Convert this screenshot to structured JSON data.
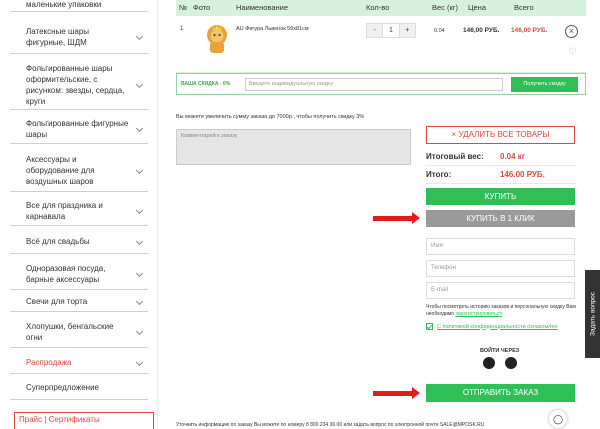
{
  "sidebar": {
    "items": [
      {
        "label": "маленькие упаковки",
        "red": false
      },
      {
        "label": "Латексные шары фигурные, ШДМ",
        "red": false
      },
      {
        "label": "Фольгированные шары оформительские, с рисунком: звезды, сердца, круги",
        "red": false
      },
      {
        "label": "Фольгированные фигурные шары",
        "red": false
      },
      {
        "label": "Аксессуары и оборудование для воздушных шаров",
        "red": false
      },
      {
        "label": "Все для праздника и карнавала",
        "red": false
      },
      {
        "label": "Всё для свадьбы",
        "red": false
      },
      {
        "label": "Одноразовая посуда, барные аксессуары",
        "red": false
      },
      {
        "label": "Свечи для торта",
        "red": false
      },
      {
        "label": "Хлопушки, бенгальские огни",
        "red": false
      },
      {
        "label": "Распродажа",
        "red": true
      },
      {
        "label": "Суперпредложение",
        "red": false
      }
    ],
    "bottom_links": "Прайс | Сертификаты"
  },
  "table": {
    "headers": {
      "num": "№",
      "photo": "Фото",
      "name": "Наименование",
      "qty": "Кол-во",
      "weight": "Вес (кг)",
      "price": "Цена",
      "total": "Всего"
    },
    "rows": [
      {
        "num": "1",
        "name": "AU Фигура Львенок 56х81см",
        "qty_minus": "-",
        "qty": "1",
        "qty_plus": "+",
        "weight": "0.04",
        "price": "146,00 РУБ.",
        "total": "146,00 РУБ."
      }
    ]
  },
  "discount": {
    "label": "ВАША СКИДКА - 0%",
    "placeholder": "Введите индивидуальную скидку",
    "button": "Получить скидку"
  },
  "hint": "Вы можете увеличить сумму заказа до 7000р., чтобы получить скидку 3%",
  "comment_placeholder": "Комментарий к заказу",
  "summary": {
    "clear_button": "УДАЛИТЬ ВСЕ ТОВАРЫ",
    "weight_label": "Итоговый вес:",
    "weight_value": "0.04 кг",
    "total_label": "Итого:",
    "total_value": "146.00 РУБ.",
    "buy_button": "КУПИТЬ",
    "one_click_button": "КУПИТЬ В 1 КЛИК"
  },
  "form": {
    "name_placeholder": "Имя",
    "phone_placeholder": "Телефон",
    "email_placeholder": "E-mail",
    "reg_text": "Чтобы посмотреть историю заказов и персональную скидку Вам необходимо",
    "reg_link": "зарегистрироваться",
    "policy_link": "С политикой конфиденциальности ознакомлен",
    "login_via": "ВОЙТИ ЧЕРЕЗ",
    "send_button": "ОТПРАВИТЬ ЗАКАЗ"
  },
  "footer_note": "Уточнить информацию по заказу Вы можете по номеру 8 800 234 36 00 или задать вопрос по электронной почте SALE@MPOSK.RU",
  "ask_tab": "Задать вопрос",
  "colors": {
    "accent_green": "#2fbf56",
    "accent_red": "#e2453c",
    "arrow_red": "#e21b1b"
  }
}
